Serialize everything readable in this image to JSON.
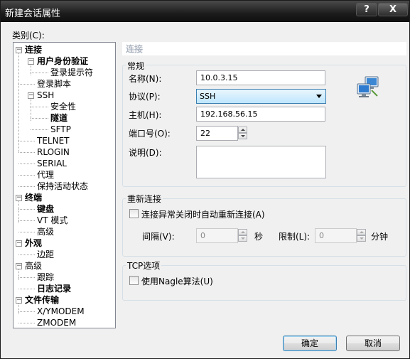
{
  "window": {
    "title": "新建会话属性",
    "help_label": "?",
    "close_label": "X"
  },
  "category": {
    "label": "类别(C):"
  },
  "tree": [
    {
      "label": "连接",
      "bold": true,
      "expander": "−"
    },
    {
      "label": "用户身份验证",
      "bold": true,
      "expander": "−"
    },
    {
      "label": "登录提示符",
      "bold": false
    },
    {
      "label": "登录脚本",
      "bold": false
    },
    {
      "label": "SSH",
      "bold": false,
      "expander": "−"
    },
    {
      "label": "安全性",
      "bold": false
    },
    {
      "label": "隧道",
      "bold": true
    },
    {
      "label": "SFTP",
      "bold": false
    },
    {
      "label": "TELNET",
      "bold": false
    },
    {
      "label": "RLOGIN",
      "bold": false
    },
    {
      "label": "SERIAL",
      "bold": false
    },
    {
      "label": "代理",
      "bold": false
    },
    {
      "label": "保持活动状态",
      "bold": false
    },
    {
      "label": "终端",
      "bold": true,
      "expander": "−"
    },
    {
      "label": "键盘",
      "bold": true
    },
    {
      "label": "VT 模式",
      "bold": false
    },
    {
      "label": "高级",
      "bold": false
    },
    {
      "label": "外观",
      "bold": true,
      "expander": "−"
    },
    {
      "label": "边距",
      "bold": false
    },
    {
      "label": "高级",
      "bold": false,
      "expander": "−"
    },
    {
      "label": "跟踪",
      "bold": false
    },
    {
      "label": "日志记录",
      "bold": true
    },
    {
      "label": "文件传输",
      "bold": true,
      "expander": "−"
    },
    {
      "label": "X/YMODEM",
      "bold": false
    },
    {
      "label": "ZMODEM",
      "bold": false
    }
  ],
  "panel": {
    "header": "连接",
    "general": {
      "title": "常规",
      "name_label": "名称(N):",
      "name_value": "10.0.3.15",
      "protocol_label": "协议(P):",
      "protocol_value": "SSH",
      "host_label": "主机(H):",
      "host_value": "192.168.56.15",
      "port_label": "端口号(O):",
      "port_value": "22",
      "desc_label": "说明(D):",
      "desc_value": "",
      "icon": "network-computers-icon"
    },
    "reconnect": {
      "title": "重新连接",
      "auto_label": "连接异常关闭时自动重新连接(A)",
      "auto_checked": false,
      "interval_label": "间隔(V):",
      "interval_value": "0",
      "interval_unit": "秒",
      "limit_label": "限制(L):",
      "limit_value": "0",
      "limit_unit": "分钟"
    },
    "tcp": {
      "title": "TCP选项",
      "nagle_label": "使用Nagle算法(U)",
      "nagle_checked": false
    }
  },
  "buttons": {
    "ok": "确定",
    "cancel": "取消"
  },
  "colors": {
    "titlebar": "#1c1c1c",
    "panel_header_text": "#aeb6c2",
    "focus_border": "#3c7fb1"
  }
}
